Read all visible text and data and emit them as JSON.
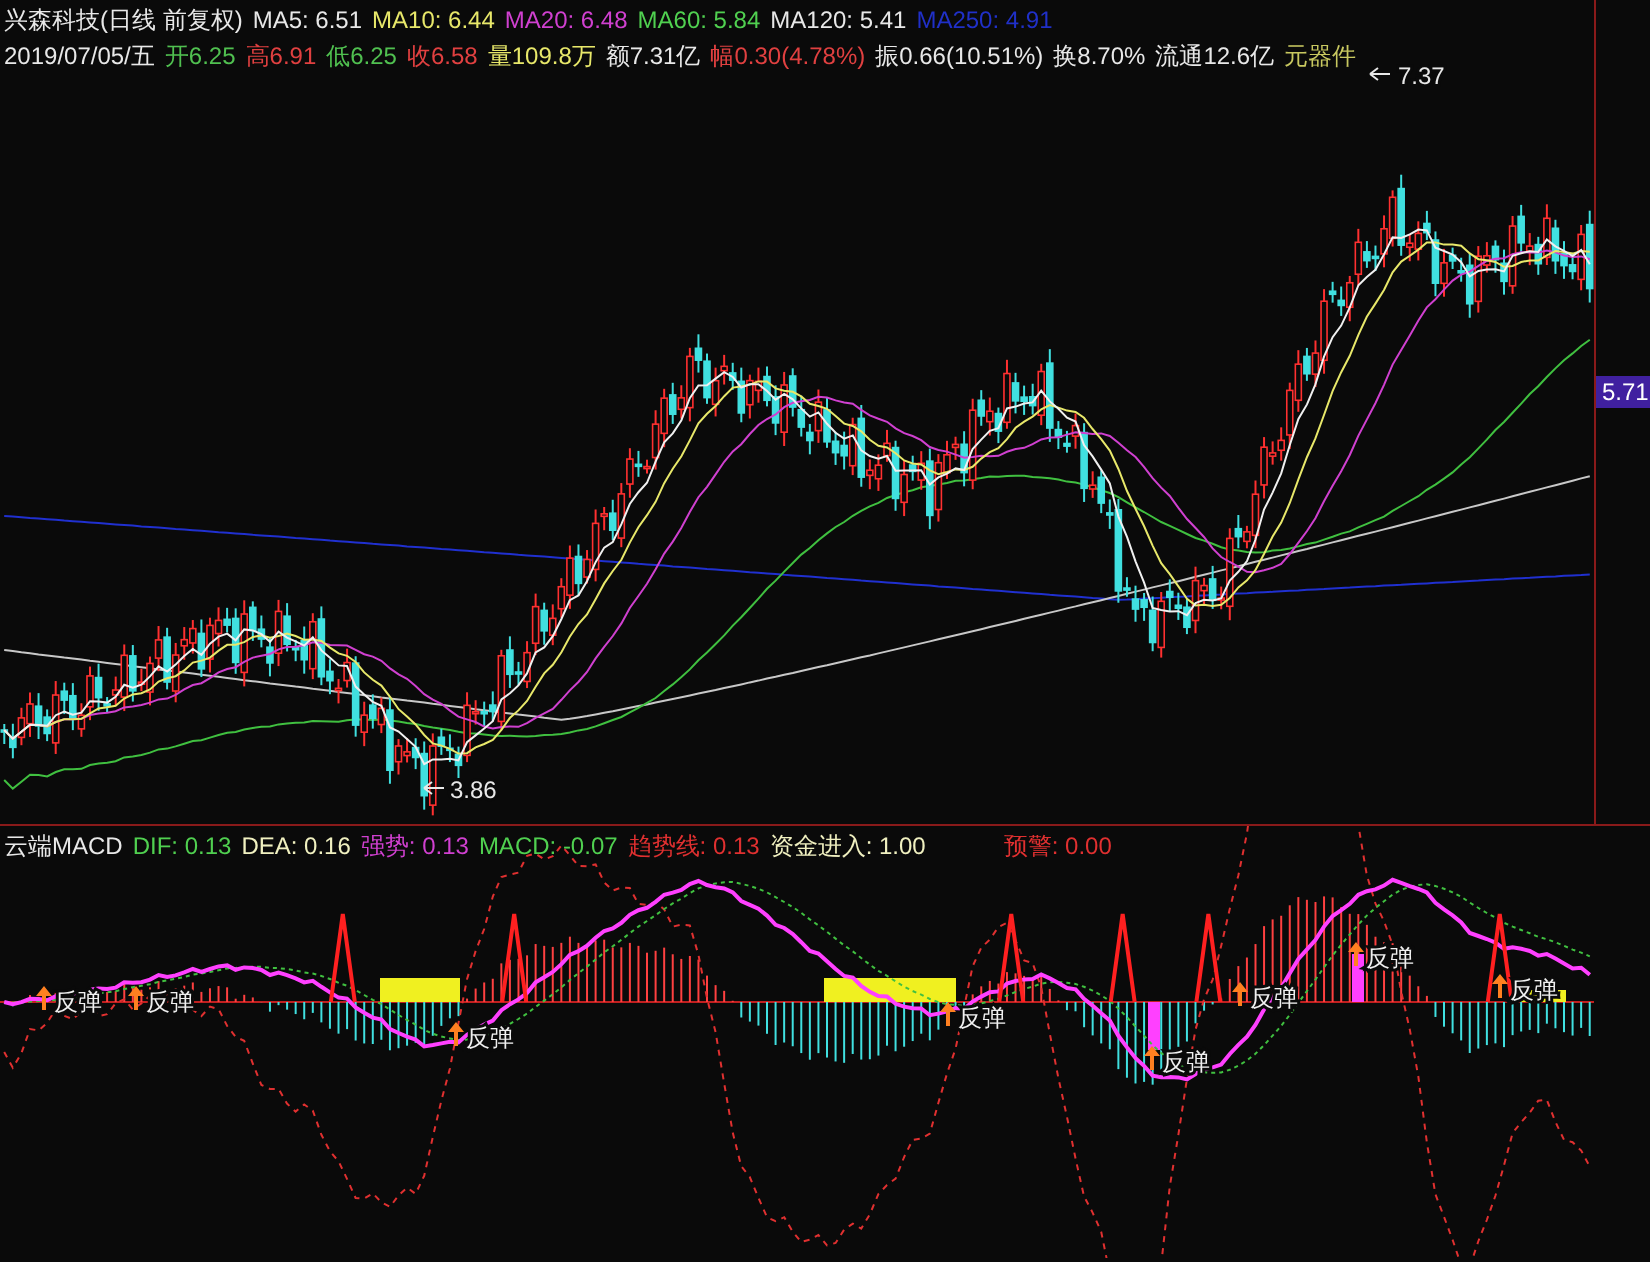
{
  "quote_header": {
    "stock": "兴森科技(日线 前复权)",
    "moving_averages": [
      {
        "label": "MA5: 6.51",
        "color": "#e8e8e8"
      },
      {
        "label": "MA10: 6.44",
        "color": "#e8e86a"
      },
      {
        "label": "MA20: 6.48",
        "color": "#d040d0"
      },
      {
        "label": "MA60: 5.84",
        "color": "#50d050"
      },
      {
        "label": "MA120: 5.41",
        "color": "#e8e8e8"
      },
      {
        "label": "MA250: 4.91",
        "color": "#2030c8"
      }
    ],
    "date": "2019/07/05/五",
    "fields": [
      {
        "text": "开6.25",
        "color": "#50c050"
      },
      {
        "text": "高6.91",
        "color": "#e04040"
      },
      {
        "text": "低6.25",
        "color": "#50c050"
      },
      {
        "text": "收6.58",
        "color": "#e04040"
      },
      {
        "text": "量109.8万",
        "color": "#e8e86a"
      },
      {
        "text": "额7.31亿",
        "color": "#e8e8e8"
      },
      {
        "text": "幅0.30(4.78%)",
        "color": "#e04040"
      },
      {
        "text": "振0.66(10.51%)",
        "color": "#e8e8e8"
      },
      {
        "text": "换8.70%",
        "color": "#e8e8e8"
      },
      {
        "text": "流通12.6亿",
        "color": "#e8e8e8"
      },
      {
        "text": "元器件",
        "color": "#c8c860"
      }
    ]
  },
  "price_chart": {
    "high_label": "7.37",
    "low_label": "3.86",
    "last_price": "5.71"
  },
  "indicator": {
    "title": "云端MACD",
    "values": [
      {
        "text": "DIF: 0.13",
        "color": "#50d050"
      },
      {
        "text": "DEA: 0.16",
        "color": "#f0f0c0"
      },
      {
        "text": "强势: 0.13",
        "color": "#d040d0"
      },
      {
        "text": "MACD: -0.07",
        "color": "#50d050"
      },
      {
        "text": "趋势线: 0.13",
        "color": "#e03030"
      },
      {
        "text": "资金进入: 1.00",
        "color": "#f0f0c0"
      },
      {
        "text": "预警: 0.00",
        "color": "#e03030"
      }
    ],
    "signals": [
      "反弹",
      "反弹",
      "反弹",
      "反弹",
      "反弹",
      "反弹",
      "反弹",
      "反弹"
    ]
  }
}
